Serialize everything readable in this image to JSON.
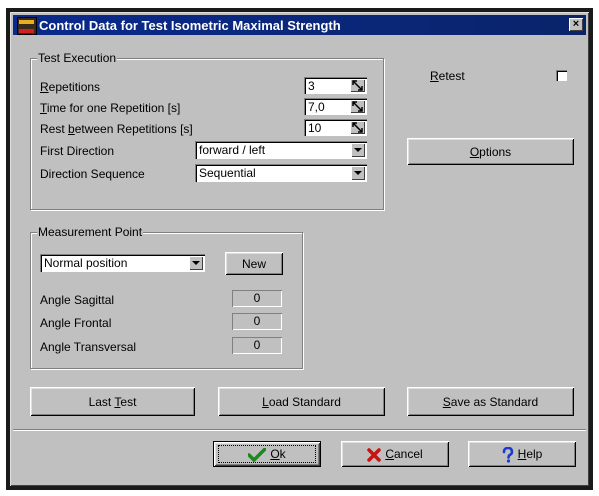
{
  "window": {
    "title": "Control Data for Test Isometric Maximal Strength",
    "close_glyph": "×"
  },
  "test_execution": {
    "group_title": "Test Execution",
    "repetitions": {
      "label_u": "R",
      "label_rest": "epetitions",
      "value": "3"
    },
    "time_rep": {
      "label_u": "T",
      "label_rest": "ime for one Repetition [s]",
      "value": "7,0"
    },
    "rest_between": {
      "label_pre": "Rest ",
      "label_u": "b",
      "label_rest": "etween Repetitions [s]",
      "value": "10"
    },
    "first_direction": {
      "label": "First Direction",
      "value": "forward / left"
    },
    "direction_sequence": {
      "label": "Direction Sequence",
      "value": "Sequential"
    }
  },
  "retest": {
    "label_u": "R",
    "label_rest": "etest",
    "checked": false
  },
  "options_button": {
    "label_u": "O",
    "label_rest": "ptions"
  },
  "measurement_point": {
    "group_title": "Measurement Point",
    "position": "Normal position",
    "new_label": "New",
    "angle_sagittal": {
      "label": "Angle Sagittal",
      "value": "0"
    },
    "angle_frontal": {
      "label": "Angle Frontal",
      "value": "0"
    },
    "angle_transversal": {
      "label": "Angle Transversal",
      "value": "0"
    }
  },
  "actions": {
    "last_test": {
      "label_pre": "Last ",
      "label_u": "T",
      "label_rest": "est"
    },
    "load_standard": {
      "label_u": "L",
      "label_rest": "oad Standard"
    },
    "save_standard": {
      "label_u": "S",
      "label_rest": "ave as Standard"
    }
  },
  "footer": {
    "ok": {
      "label_u": "O",
      "label_rest": "k",
      "icon": "checkmark-icon",
      "color": "#1a8a1a"
    },
    "cancel": {
      "label_u": "C",
      "label_rest": "ancel",
      "icon": "x-icon",
      "color": "#cc1111"
    },
    "help": {
      "label_u": "H",
      "label_rest": "elp",
      "icon": "question-icon",
      "color": "#1a3ad0"
    }
  }
}
